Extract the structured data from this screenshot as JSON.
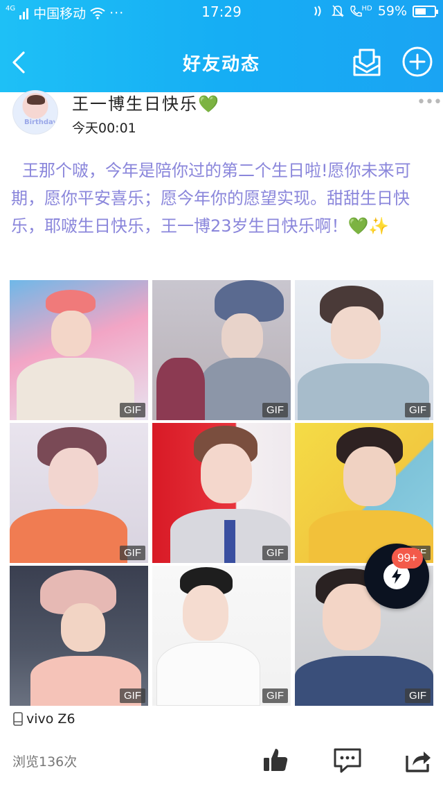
{
  "status_bar": {
    "carrier": "中国移动",
    "network": "4G",
    "time": "17:29",
    "hd_label": "HD",
    "battery": "59%",
    "battery_level": 0.59
  },
  "nav": {
    "title": "好友动态"
  },
  "post": {
    "author": "王一博生日快乐",
    "author_emoji": "💚",
    "avatar_text": "Birthday",
    "time": "今天00:01",
    "more": "•••",
    "text": "王那个啵，今年是陪你过的第二个生日啦!愿你未来可期，愿你平安喜乐；愿今年你的愿望实现。甜甜生日快乐，耶啵生日快乐，王一博23岁生日快乐啊！💚✨",
    "gif_label": "GIF",
    "device": "vivo Z6",
    "views": "浏览136次"
  },
  "floating": {
    "badge": "99+"
  },
  "colors": {
    "header_start": "#1ec0f6",
    "header_end": "#1aa4f3",
    "post_text": "#8a86db",
    "badge": "#f35a4a"
  }
}
